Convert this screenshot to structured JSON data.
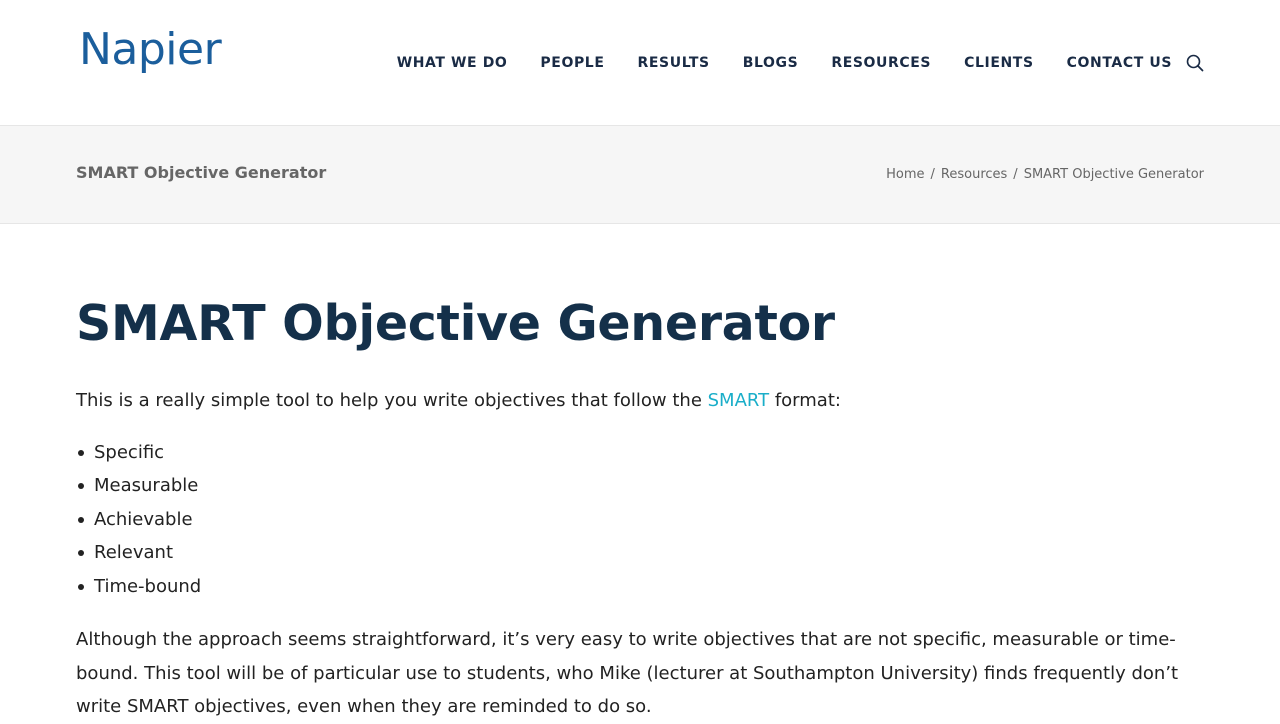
{
  "header": {
    "logo_text": "Napier",
    "nav": [
      {
        "label": "WHAT WE DO"
      },
      {
        "label": "PEOPLE"
      },
      {
        "label": "RESULTS"
      },
      {
        "label": "BLOGS"
      },
      {
        "label": "RESOURCES"
      },
      {
        "label": "CLIENTS"
      },
      {
        "label": "CONTACT US"
      }
    ],
    "search_icon": "search-icon"
  },
  "titlebar": {
    "title": "SMART Objective Generator",
    "breadcrumb": [
      {
        "label": "Home"
      },
      {
        "label": "Resources"
      },
      {
        "label": "SMART Objective Generator"
      }
    ],
    "separator": "/"
  },
  "main": {
    "heading": "SMART Objective Generator",
    "intro_before": "This is a really simple tool to help you write objectives that follow the ",
    "intro_link": "SMART",
    "intro_after": " format:",
    "criteria": [
      "Specific",
      "Measurable",
      "Achievable",
      "Relevant",
      "Time-bound"
    ],
    "paragraph": "Although the approach seems straightforward, it’s very easy to write objectives that are not specific, measurable or time-bound. This tool will be of particular use to students, who Mike (lecturer at Southampton University)  finds frequently don’t write SMART objectives, even when they are reminded to do so."
  },
  "colors": {
    "brand": "#1b5e9c",
    "nav_text": "#1a2b45",
    "heading": "#14304a",
    "link": "#1aaec9",
    "titlebar_bg": "#f6f6f6"
  }
}
